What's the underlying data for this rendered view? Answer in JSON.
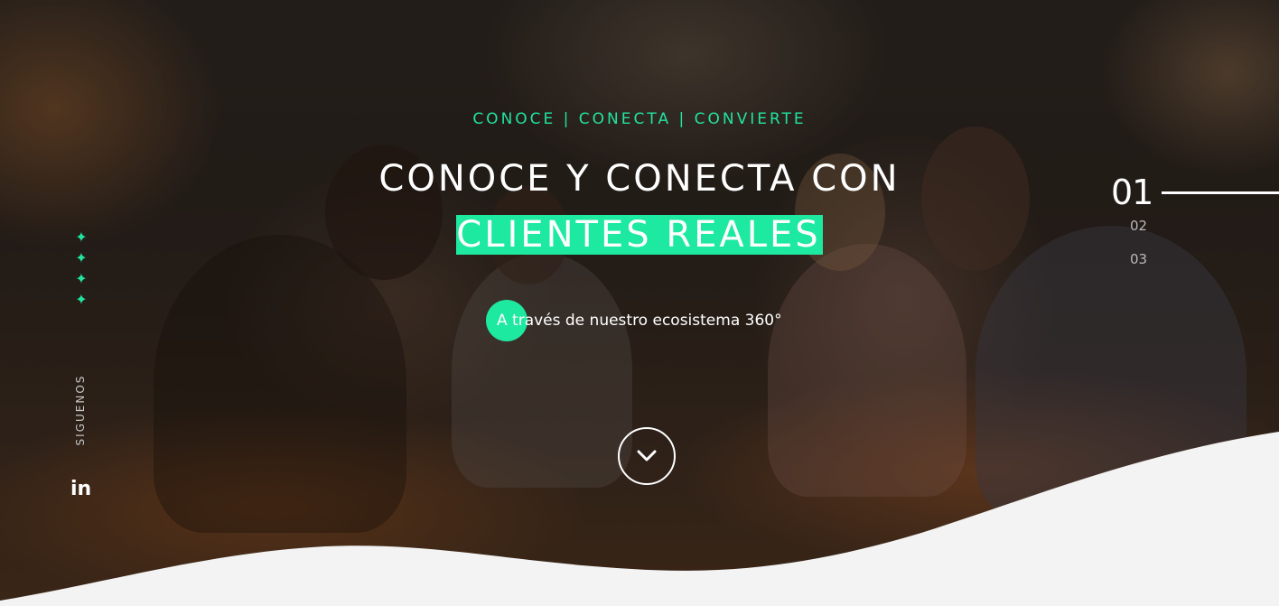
{
  "hero": {
    "tagline": "CONOCE | CONECTA | CONVIERTE",
    "headline_line1": "CONOCE Y CONECTA CON",
    "headline_highlight": "CLIENTES REALES",
    "subline": "A través de nuestro ecosistema 360°",
    "scroll_icon": "chevron-down-icon"
  },
  "social": {
    "label": "SIGUENOS",
    "linkedin_text": "in",
    "linkedin_icon": "linkedin-icon"
  },
  "decor": {
    "sparkle_icon": "sparkle-icon",
    "sparkle": "✦"
  },
  "slides": {
    "current": "01",
    "items": [
      "02",
      "03"
    ]
  },
  "colors": {
    "accent": "#1ee9a0",
    "text": "#ffffff",
    "wave": "#f3f3f3"
  }
}
